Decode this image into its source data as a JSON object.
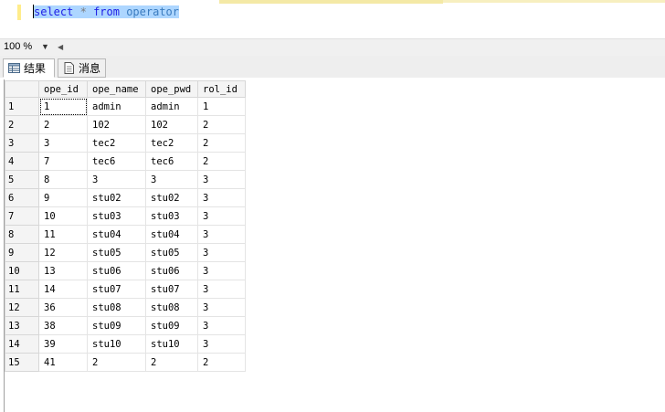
{
  "query": {
    "keyword_select": "select",
    "star": "*",
    "keyword_from": "from",
    "table": "operator"
  },
  "zoom": {
    "value": "100 %"
  },
  "tabs": [
    {
      "label": "结果",
      "icon": "grid-icon",
      "active": true
    },
    {
      "label": "消息",
      "icon": "message-icon",
      "active": false
    }
  ],
  "grid": {
    "columns": [
      "ope_id",
      "ope_name",
      "ope_pwd",
      "rol_id"
    ],
    "rows": [
      {
        "num": "1",
        "cells": [
          "1",
          "admin",
          "admin",
          "1"
        ]
      },
      {
        "num": "2",
        "cells": [
          "2",
          "102",
          "102",
          "2"
        ]
      },
      {
        "num": "3",
        "cells": [
          "3",
          "tec2",
          "tec2",
          "2"
        ]
      },
      {
        "num": "4",
        "cells": [
          "7",
          "tec6",
          "tec6",
          "2"
        ]
      },
      {
        "num": "5",
        "cells": [
          "8",
          "3",
          "3",
          "3"
        ]
      },
      {
        "num": "6",
        "cells": [
          "9",
          "stu02",
          "stu02",
          "3"
        ]
      },
      {
        "num": "7",
        "cells": [
          "10",
          "stu03",
          "stu03",
          "3"
        ]
      },
      {
        "num": "8",
        "cells": [
          "11",
          "stu04",
          "stu04",
          "3"
        ]
      },
      {
        "num": "9",
        "cells": [
          "12",
          "stu05",
          "stu05",
          "3"
        ]
      },
      {
        "num": "10",
        "cells": [
          "13",
          "stu06",
          "stu06",
          "3"
        ]
      },
      {
        "num": "11",
        "cells": [
          "14",
          "stu07",
          "stu07",
          "3"
        ]
      },
      {
        "num": "12",
        "cells": [
          "36",
          "stu08",
          "stu08",
          "3"
        ]
      },
      {
        "num": "13",
        "cells": [
          "38",
          "stu09",
          "stu09",
          "3"
        ]
      },
      {
        "num": "14",
        "cells": [
          "39",
          "stu10",
          "stu10",
          "3"
        ]
      },
      {
        "num": "15",
        "cells": [
          "41",
          "2",
          "2",
          "2"
        ]
      }
    ]
  },
  "colors": {
    "keyword": "#1e1ee6",
    "selection": "#add6ff",
    "table_name": "#3a7bbf"
  }
}
